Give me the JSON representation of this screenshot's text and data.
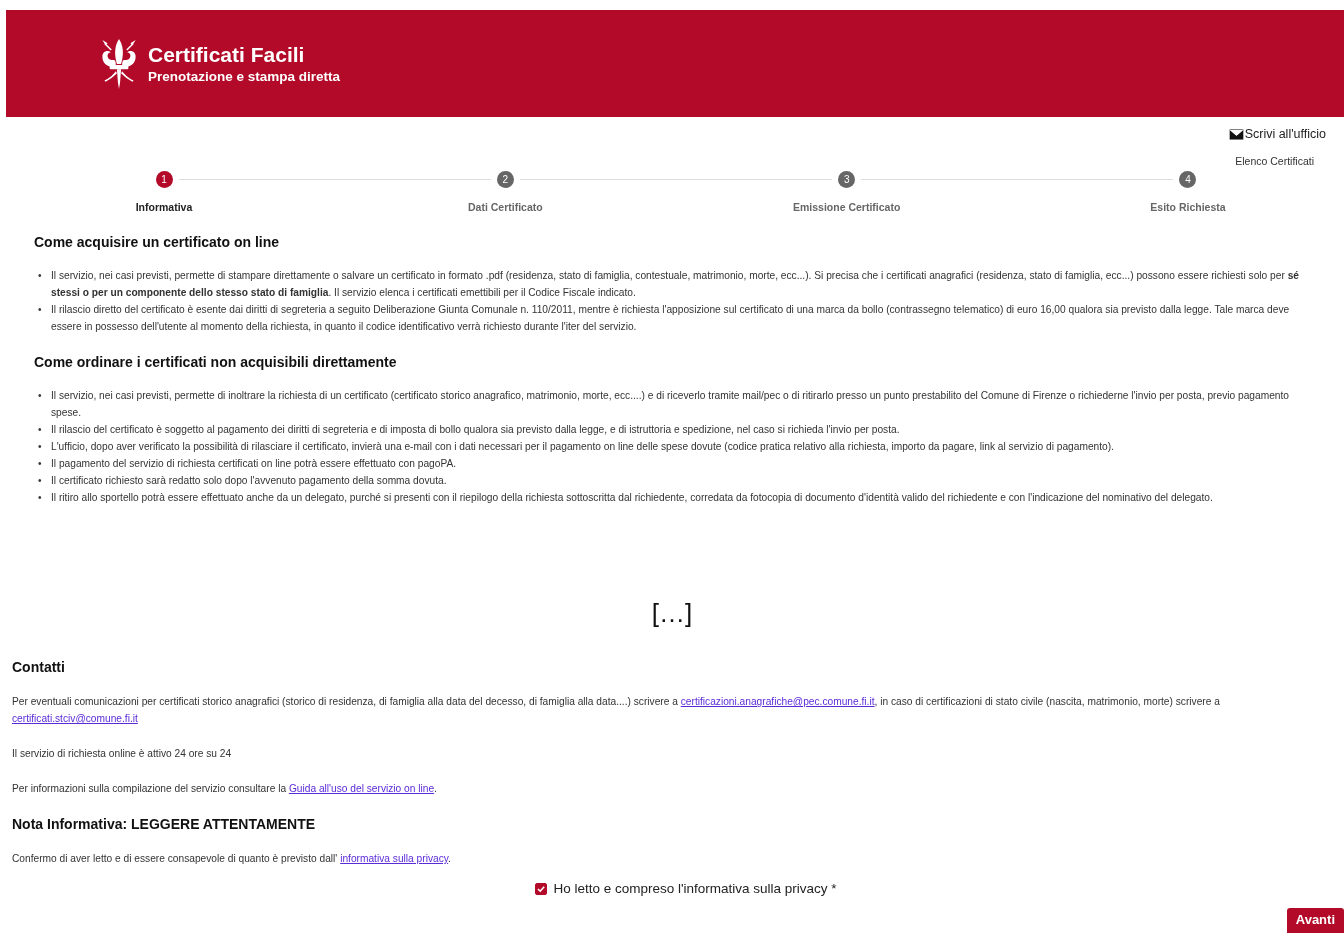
{
  "header": {
    "title": "Certificati Facili",
    "subtitle": "Prenotazione e stampa diretta"
  },
  "top_links": {
    "write_office": "Scrivi all'ufficio",
    "certificate_list": "Elenco Certificati"
  },
  "steps": [
    {
      "number": "1",
      "label": "Informativa",
      "selected": true
    },
    {
      "number": "2",
      "label": "Dati Certificato",
      "selected": false
    },
    {
      "number": "3",
      "label": "Emissione Certificato",
      "selected": false
    },
    {
      "number": "4",
      "label": "Esito Richiesta",
      "selected": false
    }
  ],
  "sections": [
    {
      "title": "Come acquisire un certificato on line",
      "bullets": [
        "Il servizio, nei casi previsti, permette di stampare direttamente o salvare un certificato in formato .pdf (residenza, stato di famiglia, contestuale, matrimonio, morte, ecc...). Si precisa che i certificati anagrafici (residenza, stato di famiglia, ecc...) possono essere richiesti solo per **sé stessi o per un componente dello stesso stato di famiglia**. Il servizio elenca i certificati emettibili per il Codice Fiscale indicato.",
        "Il rilascio diretto del certificato è esente dai diritti di segreteria a seguito Deliberazione Giunta Comunale n. 110/2011, mentre è richiesta l'apposizione sul certificato di una marca da bollo (contrassegno telematico) di euro 16,00 qualora sia previsto dalla legge. Tale marca deve essere in possesso dell'utente al momento della richiesta, in quanto il codice identificativo verrà richiesto durante l'iter del servizio."
      ]
    },
    {
      "title": "Come ordinare i certificati non acquisibili direttamente",
      "bullets": [
        "Il servizio, nei casi previsti, permette di inoltrare la richiesta di un certificato (certificato storico anagrafico, matrimonio, morte, ecc....) e di riceverlo tramite mail/pec o di ritirarlo presso un punto prestabilito del Comune di Firenze o richiederne l'invio per posta, previo pagamento spese.",
        "Il rilascio del certificato è soggetto al pagamento dei diritti di segreteria e di imposta di bollo qualora sia previsto dalla legge, e di istruttoria e spedizione, nel caso si richieda l'invio per posta.",
        "L'ufficio, dopo aver verificato la possibilità di rilasciare il certificato, invierà una e-mail con i dati necessari per il pagamento on line delle spese dovute (codice pratica relativo alla richiesta, importo da pagare, link al servizio di pagamento).",
        "Il pagamento del servizio di richiesta certificati on line potrà essere effettuato con pagoPA.",
        "Il certificato richiesto sarà redatto solo dopo l'avvenuto pagamento della somma dovuta.",
        "Il ritiro allo sportello potrà essere effettuato anche da un delegato, purché si presenti con il riepilogo della richiesta sottoscritta dal richiedente, corredata da fotocopia di documento d'identità valido del richiedente e con l'indicazione del nominativo del delegato."
      ]
    }
  ],
  "bullet_marker": "•",
  "gap_marker": "[…]",
  "contacts": {
    "title": "Contatti",
    "paragraphs": [
      [
        {
          "kind": "text",
          "text": "Per eventuali comunicazioni per certificati storico anagrafici (storico di residenza, di famiglia alla data del decesso, di famiglia alla data....) scrivere a "
        },
        {
          "kind": "link",
          "text": "certificazioni.anagrafiche@pec.comune.fi.it"
        },
        {
          "kind": "text",
          "text": ", in caso di certificazioni di stato civile (nascita, matrimonio, morte) scrivere a "
        },
        {
          "kind": "link",
          "text": "certificati.stciv@comune.fi.it"
        }
      ],
      [
        {
          "kind": "text",
          "text": "Il servizio di richiesta online è attivo 24 ore su 24"
        }
      ],
      [
        {
          "kind": "text",
          "text": "Per informazioni sulla compilazione del servizio consultare la "
        },
        {
          "kind": "link",
          "text": "Guida all'uso del servizio on line"
        },
        {
          "kind": "text",
          "text": "."
        }
      ]
    ]
  },
  "privacy": {
    "title": "Nota Informativa: LEGGERE ATTENTAMENTE",
    "paragraph": [
      {
        "kind": "text",
        "text": "Confermo di aver letto e di essere consapevole di quanto è previsto dall' "
      },
      {
        "kind": "link",
        "text": "informativa sulla privacy"
      },
      {
        "kind": "text",
        "text": "."
      }
    ],
    "checkbox": {
      "label": "Ho letto e compreso l'informativa sulla privacy *",
      "checked": true
    }
  },
  "next_button": "Avanti"
}
